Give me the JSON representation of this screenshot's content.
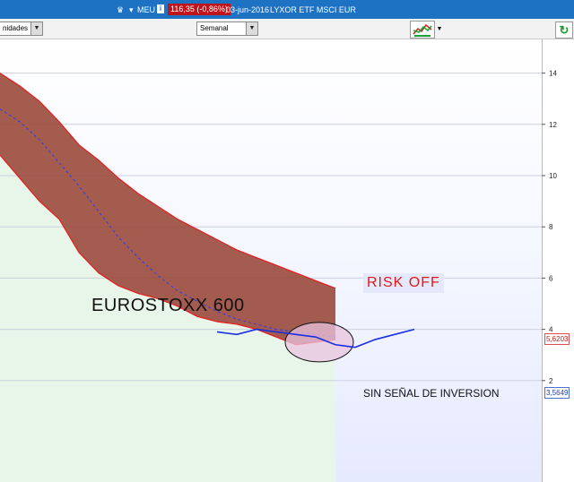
{
  "header": {
    "menu_label": "MEU",
    "info_icon": "info-icon",
    "price": "116,35 (-0,86%)",
    "date": "03-jun-2016",
    "instrument": "LYXOR ETF MSCI EUR",
    "menu_icon": "hand-menu-icon"
  },
  "toolbar": {
    "units_select": "nidades",
    "period_select": "Semanal",
    "indicator_icon": "indicators-icon",
    "refresh_icon": "refresh-icon"
  },
  "labels": {
    "upper_value": "5,6203",
    "lower_value": "3,5649"
  },
  "colors": {
    "titlebar": "#1d72c4",
    "price_box": "#c0141c",
    "band_fill": "#9a4a3c",
    "band_edge": "#e81c1c",
    "lower_line": "#1a2fe0",
    "midline": "#2a3aee",
    "highlight": "#eac3df"
  },
  "chart_data": {
    "type": "area",
    "ylim": [
      0,
      17.5
    ],
    "yticks": [
      2,
      4,
      6,
      8,
      10,
      12,
      14,
      16
    ],
    "grid": true,
    "annotations": [
      "EUROSTOXX 600",
      "RISK OFF",
      "SIN SEÑAL DE INVERSION"
    ],
    "x": [
      0,
      1,
      2,
      3,
      4,
      5,
      6,
      7,
      8,
      9,
      10,
      11,
      12,
      13,
      14,
      15,
      16,
      17,
      18,
      19,
      20,
      21,
      22
    ],
    "series": [
      {
        "values": [
          14.0,
          13.5,
          12.9,
          12.1,
          11.2,
          10.6,
          9.9,
          9.3,
          8.8,
          8.3,
          7.9,
          7.5,
          7.1,
          6.8,
          6.5,
          6.2,
          5.9,
          5.6
        ]
      },
      {
        "values": [
          12.6,
          12.1,
          11.4,
          10.5,
          9.6,
          8.6,
          7.6,
          6.8,
          6.1,
          5.5,
          5.1,
          4.7,
          4.4,
          4.2,
          4.0,
          3.9,
          3.8,
          3.7
        ]
      },
      {
        "values": [
          10.8,
          9.9,
          9.0,
          8.3,
          7.0,
          6.2,
          5.7,
          5.4,
          5.2,
          4.9,
          4.5,
          4.3,
          4.2,
          4.0,
          3.7,
          3.4,
          3.5,
          3.6
        ]
      },
      {
        "values": [
          3.9,
          3.8,
          4.0,
          3.9,
          3.8,
          3.7,
          3.4,
          3.3,
          3.6,
          3.8,
          4.0
        ]
      }
    ]
  }
}
